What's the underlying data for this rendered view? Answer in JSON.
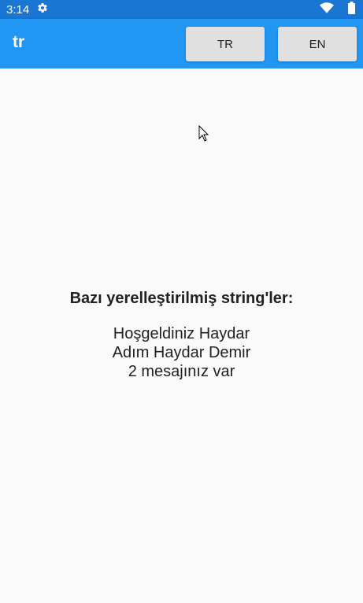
{
  "status_bar": {
    "time": "3:14",
    "icons": [
      "gear-icon",
      "wifi-icon",
      "battery-icon"
    ]
  },
  "app_bar": {
    "title": "tr",
    "buttons": {
      "tr_label": "TR",
      "en_label": "EN"
    },
    "color": "#2196f3"
  },
  "content": {
    "heading": "Bazı yerelleştirilmiş string'ler:",
    "lines": [
      "Hoşgeldiniz Haydar",
      "Adım Haydar Demir",
      "2 mesajınız var"
    ]
  }
}
